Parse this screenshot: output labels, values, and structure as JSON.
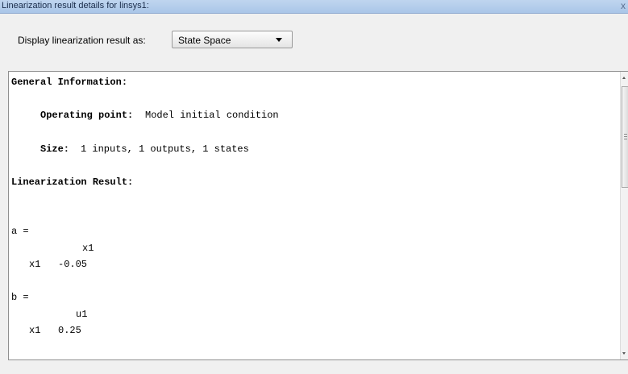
{
  "window": {
    "title": "Linearization result details for linsys1:",
    "close_glyph": "x"
  },
  "toolbar": {
    "display_label": "Display linearization result as:",
    "display_selected": "State Space"
  },
  "result": {
    "general_heading": "General Information:",
    "operating_point_label": "Operating point:",
    "operating_point_value": "Model initial condition",
    "size_label": "Size:",
    "size_value": "1 inputs, 1 outputs, 1 states",
    "linearization_heading": "Linearization Result:",
    "a_label": "a =",
    "a_col_header": "x1",
    "a_row_label": "x1",
    "a_value": "-0.05",
    "b_label": "b =",
    "b_col_header": "u1",
    "b_row_label": "x1",
    "b_value": "0.25"
  }
}
